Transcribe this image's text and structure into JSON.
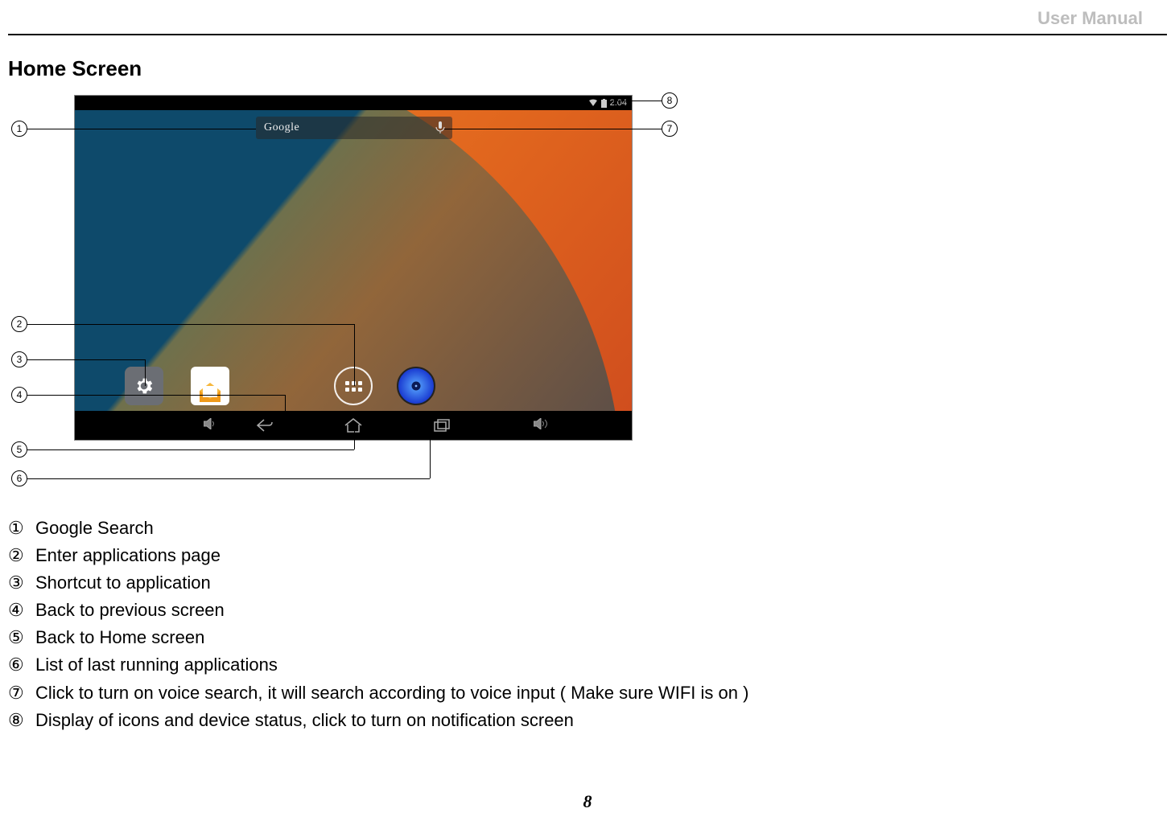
{
  "header": {
    "label": "User Manual"
  },
  "section": {
    "title": "Home Screen"
  },
  "page_number": "8",
  "statusbar": {
    "time": "2:04"
  },
  "searchbar": {
    "logo_text": "Google"
  },
  "callouts": {
    "c1": "1",
    "c2": "2",
    "c3": "3",
    "c4": "4",
    "c5": "5",
    "c6": "6",
    "c7": "7",
    "c8": "8"
  },
  "legend": [
    {
      "num": "①",
      "text": "Google Search"
    },
    {
      "num": "②",
      "text": "Enter applications page"
    },
    {
      "num": "③",
      "text": "Shortcut to application"
    },
    {
      "num": "④",
      "text": "Back to previous screen"
    },
    {
      "num": "⑤",
      "text": "Back to Home screen"
    },
    {
      "num": "⑥",
      "text": "List of last running applications"
    },
    {
      "num": "⑦",
      "text": "Click to turn on voice search, it will search according to voice input ( Make sure WIFI is on )"
    },
    {
      "num": "⑧",
      "text": "Display of icons and device status, click to turn on notification screen"
    }
  ]
}
